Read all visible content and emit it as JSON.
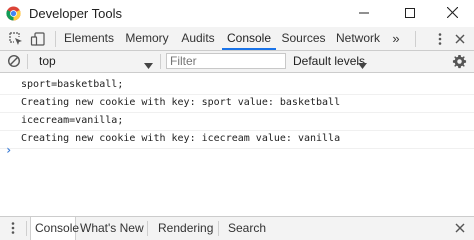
{
  "window": {
    "title": "Developer Tools",
    "icon": "chrome-icon",
    "controls": [
      "minimize-icon",
      "maximize-icon",
      "close-icon"
    ]
  },
  "toolbar": {
    "icons": [
      "inspect-element-icon",
      "device-toolbar-icon"
    ],
    "tabs": [
      "Elements",
      "Memory",
      "Audits",
      "Console",
      "Sources",
      "Network"
    ],
    "active_tab": "Console",
    "more_label": "»",
    "menu_icon": "kebab-menu-icon",
    "close_icon": "close-icon"
  },
  "filterbar": {
    "clear_icon": "clear-console-icon",
    "context": "top",
    "filter_placeholder": "Filter",
    "levels": "Default levels",
    "settings_icon": "gear-icon"
  },
  "console": {
    "lines": [
      "sport=basketball;",
      "Creating new cookie with key: sport value: basketball",
      "icecream=vanilla;",
      "Creating new cookie with key: icecream value: vanilla"
    ],
    "prompt": "›"
  },
  "drawer": {
    "menu_icon": "kebab-menu-icon",
    "tabs": [
      "Console",
      "What's New",
      "Rendering",
      "Search"
    ],
    "active_tab": "Console",
    "close_icon": "close-icon"
  },
  "colors": {
    "accent": "#1a73e8",
    "prompt": "#3a7bd5",
    "toolbar_bg": "#f3f3f3"
  }
}
